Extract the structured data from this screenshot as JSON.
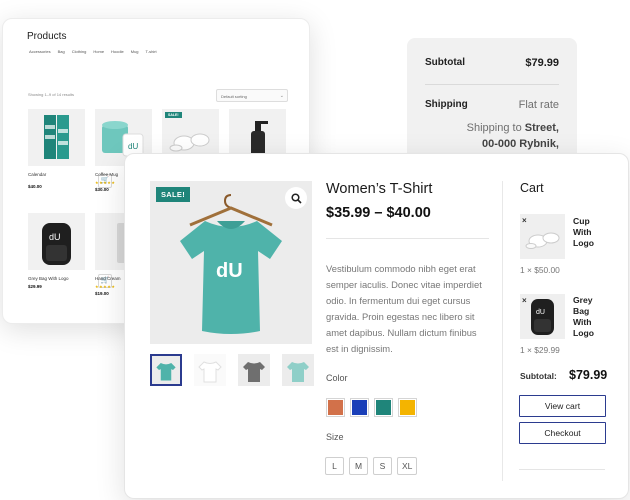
{
  "products_page": {
    "title": "Products",
    "categories": [
      "Accessories",
      "Bag",
      "Clothing",
      "Home",
      "Hoodie",
      "Mug",
      "T-shirt"
    ],
    "result_count": "Showing 1–9 of 14 results",
    "sort": "Default sorting",
    "items": [
      {
        "name": "Calendar",
        "price": "$40.00",
        "stars": "",
        "sale": false
      },
      {
        "name": "Coffee Mug",
        "price": "$30.00",
        "stars": "★★★★★",
        "sale": false
      },
      {
        "name": "",
        "price": "",
        "stars": "",
        "sale": true,
        "sale_label": "SALE!"
      },
      {
        "name": "",
        "price": "",
        "stars": "",
        "sale": false
      },
      {
        "name": "Grey Bag With Logo",
        "price": "$29.99",
        "stars": "",
        "sale": false
      },
      {
        "name": "Hand Cream",
        "price": "$19.00",
        "stars": "★★★★★",
        "sale": false
      }
    ]
  },
  "totals": {
    "subtotal_label": "Subtotal",
    "subtotal_value": "$79.99",
    "shipping_label": "Shipping",
    "shipping_value": "Flat rate",
    "shipping_to_prefix": "Shipping to",
    "shipping_to_street": "Street,",
    "shipping_to_city": "00-000 Rybnik,"
  },
  "product": {
    "sale_badge": "SALE!",
    "title": "Women’s T-Shirt",
    "price_range": "$35.99 – $40.00",
    "description": "Vestibulum commodo nibh eget erat semper iaculis. Donec vitae imperdiet odio. In fermentum dui eget cursus gravida. Proin egestas nec libero sit amet dapibus. Nullam dictum finibus est in dignissim.",
    "color_label": "Color",
    "colors": [
      "#d2714a",
      "#1a3fb8",
      "#1f857a",
      "#f4b400"
    ],
    "size_label": "Size",
    "sizes": [
      "L",
      "M",
      "S",
      "XL"
    ],
    "accent_color": "#1f857a",
    "brand_text": "dU"
  },
  "cart": {
    "title": "Cart",
    "items": [
      {
        "name_lines": [
          "Cup",
          "With",
          "Logo"
        ],
        "qty": "1 × $50.00"
      },
      {
        "name_lines": [
          "Grey",
          "Bag",
          "With",
          "Logo"
        ],
        "qty": "1 × $29.99"
      }
    ],
    "subtotal_label": "Subtotal:",
    "subtotal_value": "$79.99",
    "view_cart": "View cart",
    "checkout": "Checkout",
    "remove_symbol": "×"
  }
}
